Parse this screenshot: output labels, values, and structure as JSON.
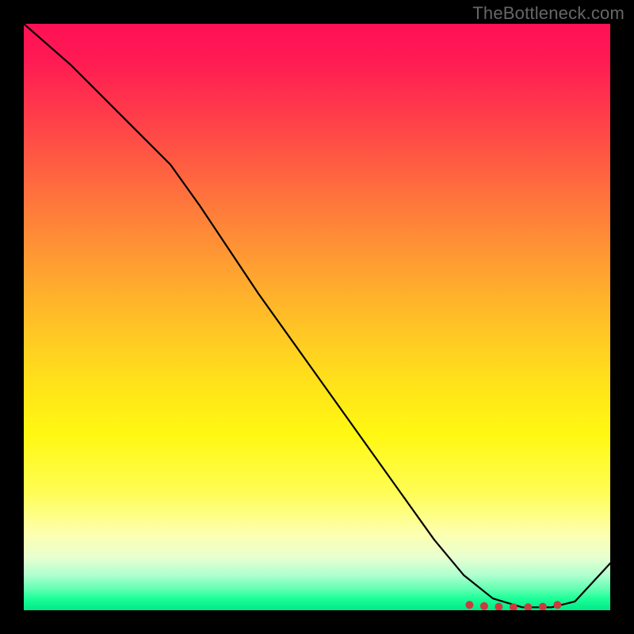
{
  "watermark": "TheBottleneck.com",
  "chart_data": {
    "type": "line",
    "title": "",
    "xlabel": "",
    "ylabel": "",
    "xlim": [
      0,
      100
    ],
    "ylim": [
      0,
      100
    ],
    "series": [
      {
        "name": "curve",
        "x": [
          0,
          8,
          18,
          25,
          30,
          40,
          50,
          60,
          70,
          75,
          80,
          85,
          90,
          94,
          100
        ],
        "values": [
          100,
          93,
          83,
          76,
          69,
          54,
          40,
          26,
          12,
          6,
          2,
          0.5,
          0.5,
          1.5,
          8
        ]
      }
    ],
    "markers": {
      "name": "points",
      "x": [
        76,
        78.5,
        81,
        83.5,
        86,
        88.5,
        91
      ],
      "values": [
        0.9,
        0.7,
        0.6,
        0.5,
        0.5,
        0.6,
        0.9
      ],
      "color": "#cc3b3b",
      "radius_px": 5
    },
    "gradient_stops": [
      {
        "pos": 0.0,
        "color": "#ff1055"
      },
      {
        "pos": 0.5,
        "color": "#ffc525"
      },
      {
        "pos": 0.8,
        "color": "#fffd55"
      },
      {
        "pos": 0.97,
        "color": "#5dffb0"
      },
      {
        "pos": 1.0,
        "color": "#00e98a"
      }
    ]
  }
}
